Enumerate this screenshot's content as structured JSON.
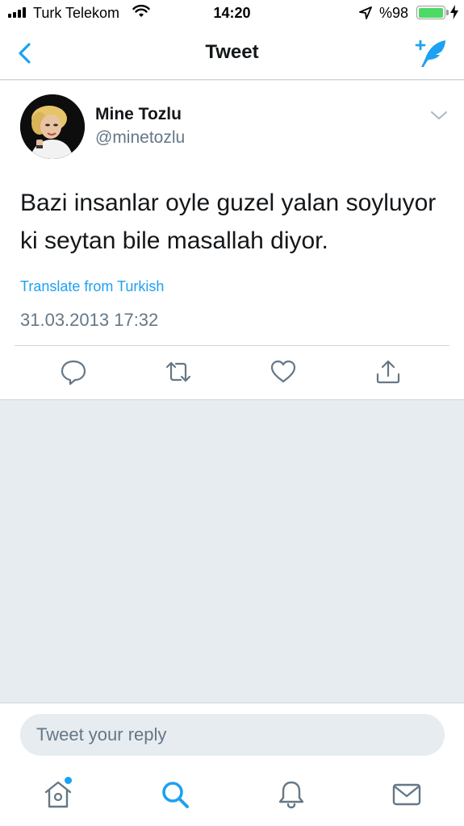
{
  "status_bar": {
    "carrier": "Turk Telekom",
    "time": "14:20",
    "battery": "%98",
    "icons": [
      "signal-icon",
      "wifi-icon",
      "location-icon",
      "battery-icon",
      "charging-icon"
    ]
  },
  "nav": {
    "title": "Tweet",
    "back_icon": "chevron-left-icon",
    "compose_icon": "compose-tweet-icon"
  },
  "tweet": {
    "author_name": "Mine Tozlu",
    "author_handle": "@minetozlu",
    "text_line1": "Bazi insanlar oyle guzel yalan soyluyor",
    "text_line2": "ki seytan bile masallah diyor.",
    "translate_label": "Translate from Turkish",
    "timestamp": "31.03.2013 17:32",
    "actions": [
      "reply-icon",
      "retweet-icon",
      "like-icon",
      "share-icon"
    ]
  },
  "reply": {
    "placeholder": "Tweet your reply"
  },
  "tab_bar": {
    "tabs": [
      "home-icon",
      "search-icon",
      "notifications-icon",
      "messages-icon"
    ],
    "has_new_home_content": true
  },
  "colors": {
    "accent": "#1da1f2",
    "text_primary": "#14171a",
    "text_secondary": "#657786",
    "background": "#e6ecf0",
    "battery_fill": "#4cd964"
  }
}
